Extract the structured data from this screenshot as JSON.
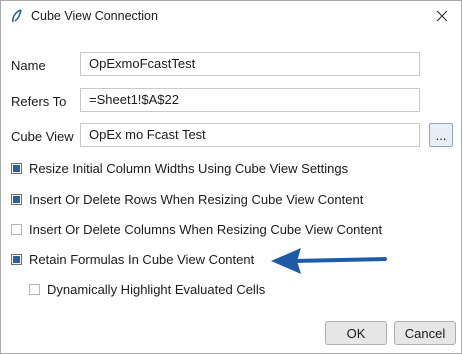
{
  "window": {
    "title": "Cube View Connection",
    "logo_icon": "app-logo-icon",
    "close_icon": "close-icon"
  },
  "fields": {
    "name_label": "Name",
    "name_value": "OpExmoFcastTest",
    "refers_to_label": "Refers To",
    "refers_to_value": "=Sheet1!$A$22",
    "cube_view_label": "Cube View",
    "cube_view_value": "OpEx mo Fcast Test",
    "browse_button_label": "..."
  },
  "options": [
    {
      "label": "Resize Initial Column Widths Using Cube View Settings",
      "checked": true
    },
    {
      "label": "Insert Or Delete Rows When Resizing Cube View Content",
      "checked": true
    },
    {
      "label": "Insert Or Delete Columns When Resizing Cube View Content",
      "checked": false
    },
    {
      "label": "Retain Formulas In Cube View Content",
      "checked": true
    },
    {
      "label": "Dynamically Highlight Evaluated Cells",
      "checked": false
    }
  ],
  "annotation": {
    "arrow_icon": "arrow-left-icon",
    "color": "#1f5aa6"
  },
  "buttons": {
    "ok_label": "OK",
    "cancel_label": "Cancel"
  },
  "colors": {
    "accent": "#2b5f9e",
    "arrow": "#1f5aa6"
  }
}
